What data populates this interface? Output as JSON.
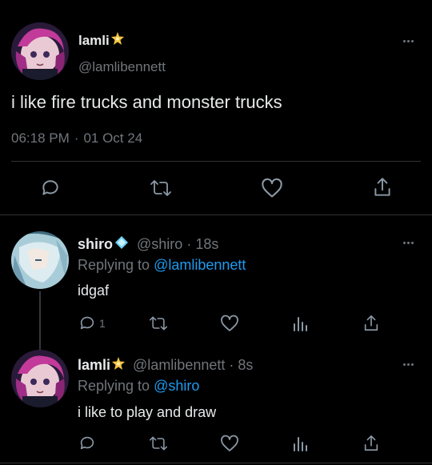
{
  "main_tweet": {
    "display_name": "lamli",
    "handle": "@lamlibennett",
    "text": "i like fire trucks and monster trucks",
    "time": "06:18 PM",
    "separator": "·",
    "date": "01 Oct 24"
  },
  "reply1": {
    "display_name": "shiro",
    "handle": "@shiro",
    "dot": "·",
    "age": "18s",
    "replying_prefix": "Replying to",
    "replying_to": "@lamlibennett",
    "text": "idgaf",
    "reply_count": "1"
  },
  "reply2": {
    "display_name": "lamli",
    "handle": "@lamlibennett",
    "dot": "·",
    "age": "8s",
    "replying_prefix": "Replying to",
    "replying_to": "@shiro",
    "text": "i like to play and draw"
  },
  "icons": {
    "reply": "reply-icon",
    "retweet": "retweet-icon",
    "like": "heart-icon",
    "share": "share-icon",
    "analytics": "analytics-icon",
    "more": "more-icon",
    "badge_star": "star-badge-icon",
    "badge_diamond": "diamond-badge-icon"
  },
  "colors": {
    "background": "#000000",
    "text": "#e7e9ea",
    "muted": "#71767b",
    "accent": "#1d9bf0",
    "divider": "#2f3336"
  }
}
